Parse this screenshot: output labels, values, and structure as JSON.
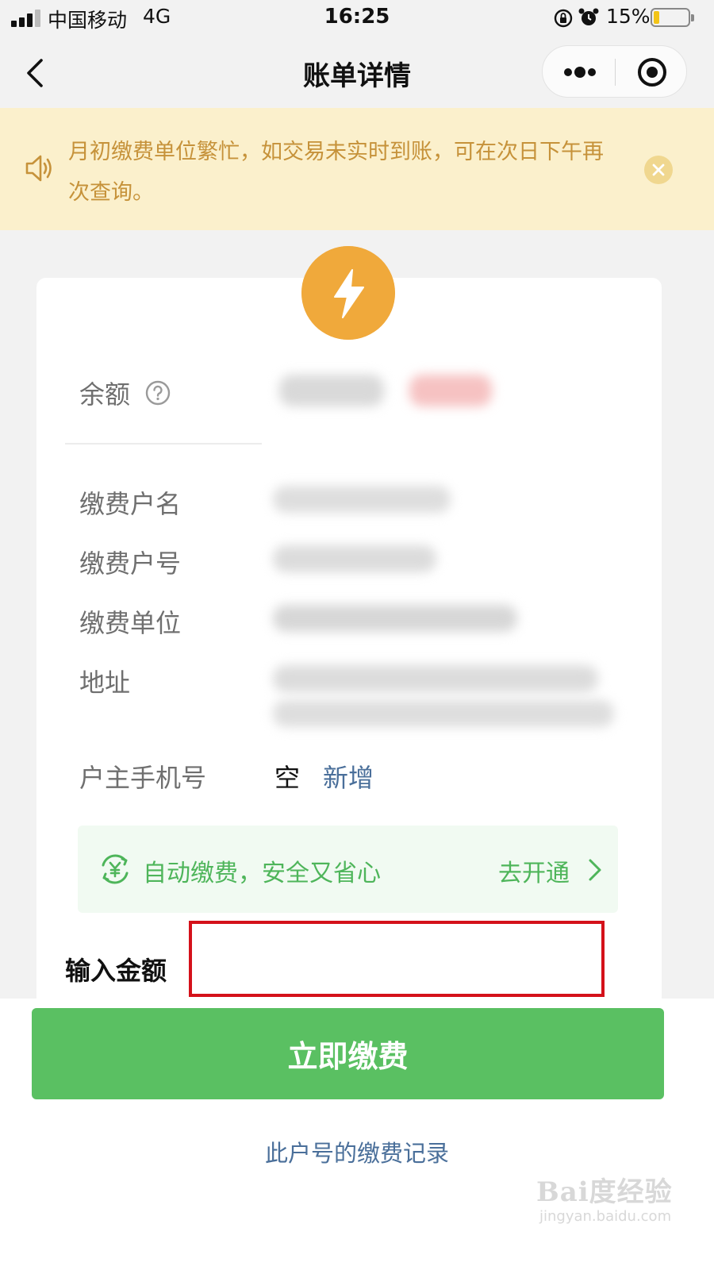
{
  "status_bar": {
    "carrier": "中国移动",
    "network": "4G",
    "time": "16:25",
    "battery_percent": "15%",
    "battery_level": 0.15,
    "icons": [
      "signal-icon",
      "orientation-lock-icon",
      "alarm-icon",
      "battery-icon"
    ]
  },
  "nav": {
    "title": "账单详情",
    "icons": [
      "back-icon",
      "more-icon",
      "miniprogram-close-icon"
    ]
  },
  "notice": {
    "text": "月初缴费单位繁忙，如交易未实时到账，可在次日下午再次查询。",
    "icons": [
      "speaker-icon",
      "close-icon"
    ]
  },
  "bill": {
    "badge_icon": "lightning-icon",
    "balance_label": "余额",
    "fields": [
      {
        "label": "缴费户名"
      },
      {
        "label": "缴费户号"
      },
      {
        "label": "缴费单位"
      },
      {
        "label": "地址"
      }
    ],
    "owner_phone_label": "户主手机号",
    "owner_phone_value": "空",
    "owner_phone_action": "新增"
  },
  "autopay": {
    "icon": "yen-cycle-icon",
    "text": "自动缴费，安全又省心",
    "action": "去开通"
  },
  "amount": {
    "label": "输入金额",
    "value": ""
  },
  "pay_button_label": "立即缴费",
  "history_link": "此户号的缴费记录",
  "watermark": {
    "main": "Bai度经验",
    "sub": "jingyan.baidu.com"
  },
  "colors": {
    "primary_green": "#5ac062",
    "accent_orange": "#f0a93b",
    "notice_bg": "#fbf0cc",
    "notice_text": "#c6923a",
    "link_blue": "#4a6f9a",
    "highlight_red": "#d4111a"
  }
}
